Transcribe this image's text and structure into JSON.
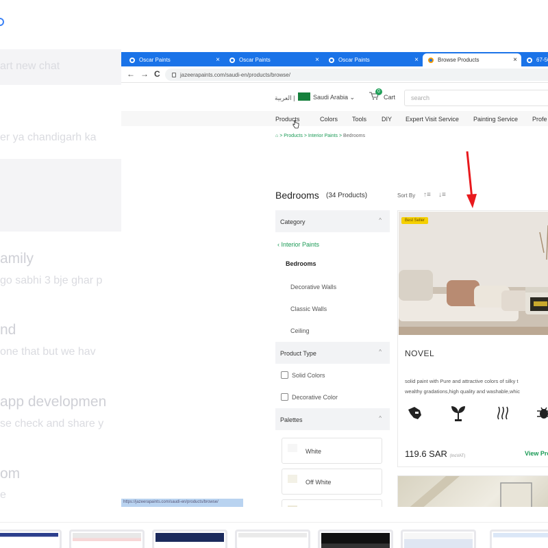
{
  "background": {
    "lines": [
      "art new chat",
      "er ya chandigarh ka",
      "amily",
      "go sabhi 3 bje ghar p",
      "nd",
      "one that but we hav",
      "app developmen",
      "se check and share y",
      "om",
      "e"
    ]
  },
  "browser": {
    "tabs": [
      {
        "label": "Oscar Paints"
      },
      {
        "label": "Oscar Paints"
      },
      {
        "label": "Oscar Paints"
      },
      {
        "label": "Browse Products"
      },
      {
        "label": "67-50"
      }
    ],
    "close_glyph": "×",
    "nav": {
      "back": "←",
      "forward": "→",
      "reload": "C"
    },
    "url": "jazeerapaints.com/saudi-en/products/browse/",
    "status_url": "https://jazeerapaints.com/saudi-en/products/browse/"
  },
  "site": {
    "lang": "العربية |",
    "country": "Saudi Arabia ⌄",
    "cart_count": "0",
    "cart_label": "Cart",
    "search_placeholder": "search",
    "nav": [
      "Products",
      "Colors",
      "Tools",
      "DIY",
      "Expert Visit Service",
      "Painting Service",
      "Profe"
    ],
    "breadcrumb": {
      "home_icon": "home-icon",
      "sep": ">",
      "items": [
        "Products",
        "Interior Paints"
      ],
      "current": "Bedrooms"
    },
    "title": "Bedrooms",
    "count": "(34 Products)",
    "sort_label": "Sort By",
    "sort_asc": "↑≡",
    "sort_desc": "↓≡"
  },
  "sidebar": {
    "category_header": "Category",
    "back_link": "‹  Interior Paints",
    "selected": "Bedrooms",
    "subitems": [
      "Decorative Walls",
      "Classic Walls",
      "Ceiling"
    ],
    "product_type_header": "Product Type",
    "product_types": [
      "Solid Colors",
      "Decorative Color"
    ],
    "palettes_header": "Palettes",
    "palettes": [
      "White",
      "Off White"
    ],
    "chevron": "^"
  },
  "product": {
    "badge": "Best Seller",
    "name": "NOVEL",
    "description_lines": [
      "solid paint with Pure and attractive colors of silky t",
      "wealthy gradations,high quality and washable,whic"
    ],
    "features": [
      "hand-icon",
      "plant-icon",
      "heat-icon",
      "bug-icon"
    ],
    "price": "119.6 SAR",
    "vat": "(IncVAT)",
    "view_label": "View Pro"
  },
  "colors": {
    "tab_blue": "#1a73e8",
    "brand_green": "#1a9a55",
    "badge_yellow": "#f5d000",
    "arrow_red": "#e8191d"
  }
}
